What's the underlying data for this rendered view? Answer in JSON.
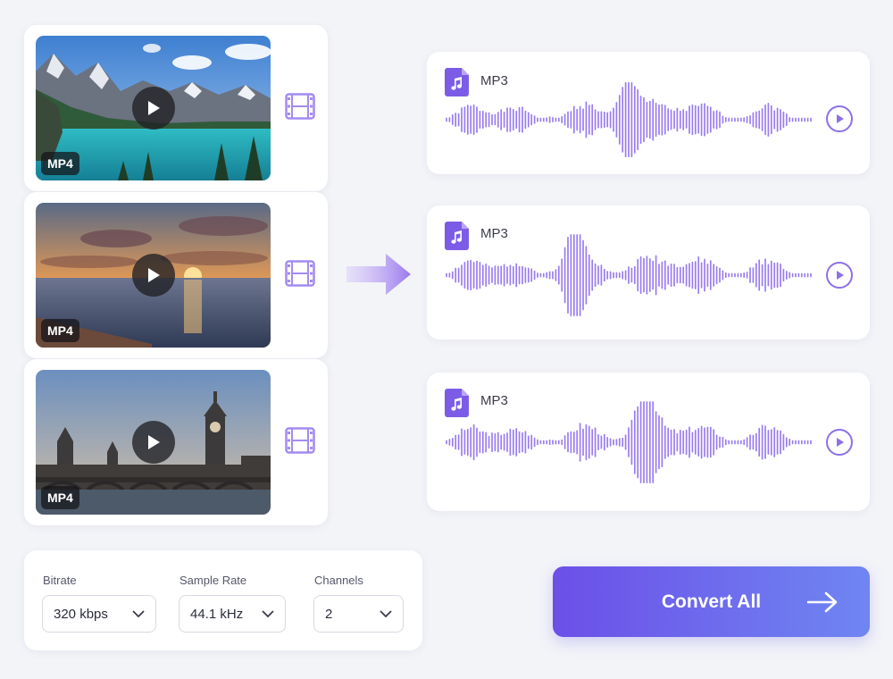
{
  "colors": {
    "accent": "#8d70e8",
    "wave": "#9a7cf0",
    "button_start": "#6c4fe8",
    "button_end": "#6f86f2"
  },
  "videos": [
    {
      "format": "MP4",
      "scene": "mountain-lake",
      "icon": "film-icon"
    },
    {
      "format": "MP4",
      "scene": "sunset-sea",
      "icon": "film-icon"
    },
    {
      "format": "MP4",
      "scene": "london-bridge",
      "icon": "film-icon"
    }
  ],
  "audios": [
    {
      "format": "MP3",
      "icon": "music-file-icon"
    },
    {
      "format": "MP3",
      "icon": "music-file-icon"
    },
    {
      "format": "MP3",
      "icon": "music-file-icon"
    }
  ],
  "settings": {
    "bitrate": {
      "label": "Bitrate",
      "value": "320 kbps"
    },
    "sample_rate": {
      "label": "Sample Rate",
      "value": "44.1 kHz"
    },
    "channels": {
      "label": "Channels",
      "value": "2"
    }
  },
  "convert_button": {
    "label": "Convert All"
  }
}
